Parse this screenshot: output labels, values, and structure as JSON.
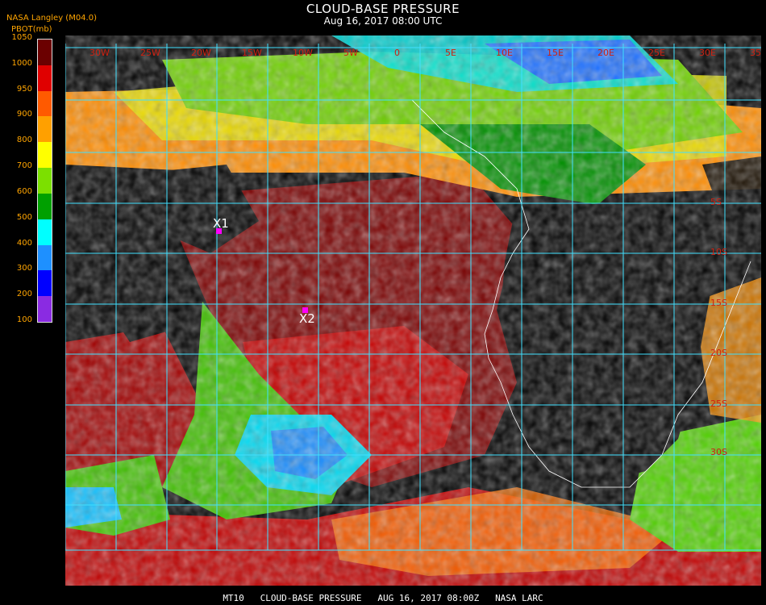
{
  "header": {
    "title": "CLOUD-BASE PRESSURE",
    "subtitle": "Aug 16, 2017 08:00 UTC",
    "credit": "NASA Langley (M04.0)",
    "unit": "PBOT(mb)"
  },
  "legend": {
    "ticks": [
      "1050",
      "1000",
      "950",
      "900",
      "800",
      "700",
      "600",
      "500",
      "400",
      "300",
      "200",
      "100"
    ],
    "bands": [
      "#6b0000",
      "#e00000",
      "#ff5a00",
      "#ffa000",
      "#ffff00",
      "#7ce000",
      "#00a000",
      "#00ffff",
      "#1e90ff",
      "#0000ff",
      "#8a2be2"
    ]
  },
  "map": {
    "markers": [
      {
        "label": "X1",
        "color": "#ff00ff"
      },
      {
        "label": "X2",
        "color": "#ff00ff"
      }
    ],
    "top_lon_labels": [
      "30W",
      "25W",
      "20W",
      "15W",
      "10W",
      "5W",
      "0",
      "5E",
      "10E",
      "15E",
      "20E",
      "25E",
      "30E",
      "35E"
    ],
    "right_lat_labels": [
      "5S",
      "10S",
      "15S",
      "20S",
      "25S",
      "30S"
    ],
    "grid_color": "#40e0ff"
  },
  "footer": {
    "text": "MT10   CLOUD-BASE PRESSURE   AUG 16, 2017 08:00Z   NASA LARC"
  }
}
